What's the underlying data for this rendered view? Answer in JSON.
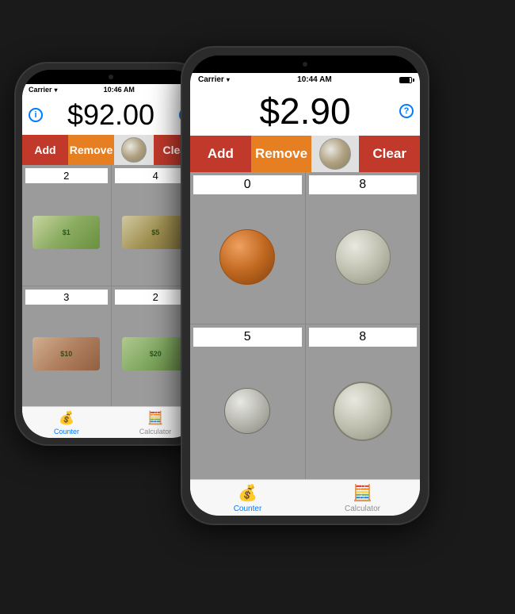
{
  "phones": {
    "small": {
      "status": {
        "carrier": "Carrier",
        "time": "10:46 AM"
      },
      "amount": "$92.00",
      "buttons": {
        "add": "Add",
        "remove": "Remove",
        "clear": "Clear"
      },
      "grid": [
        {
          "count": "2",
          "type": "bill-1",
          "label": "$1"
        },
        {
          "count": "4",
          "type": "bill-5",
          "label": "$5"
        },
        {
          "count": "3",
          "type": "bill-10",
          "label": "$10"
        },
        {
          "count": "2",
          "type": "bill-20",
          "label": "$20"
        }
      ],
      "tabs": [
        {
          "label": "Counter",
          "active": true
        },
        {
          "label": "Calculator",
          "active": false
        }
      ]
    },
    "large": {
      "status": {
        "carrier": "Carrier",
        "time": "10:44 AM"
      },
      "amount": "$2.90",
      "buttons": {
        "add": "Add",
        "remove": "Remove",
        "clear": "Clear"
      },
      "grid": [
        {
          "count": "0",
          "type": "coin-penny",
          "label": "penny"
        },
        {
          "count": "8",
          "type": "coin-nickel",
          "label": "nickel"
        },
        {
          "count": "5",
          "type": "coin-dime",
          "label": "dime"
        },
        {
          "count": "8",
          "type": "coin-quarter",
          "label": "quarter"
        }
      ],
      "tabs": [
        {
          "label": "Counter",
          "active": true
        },
        {
          "label": "Calculator",
          "active": false
        }
      ]
    }
  }
}
